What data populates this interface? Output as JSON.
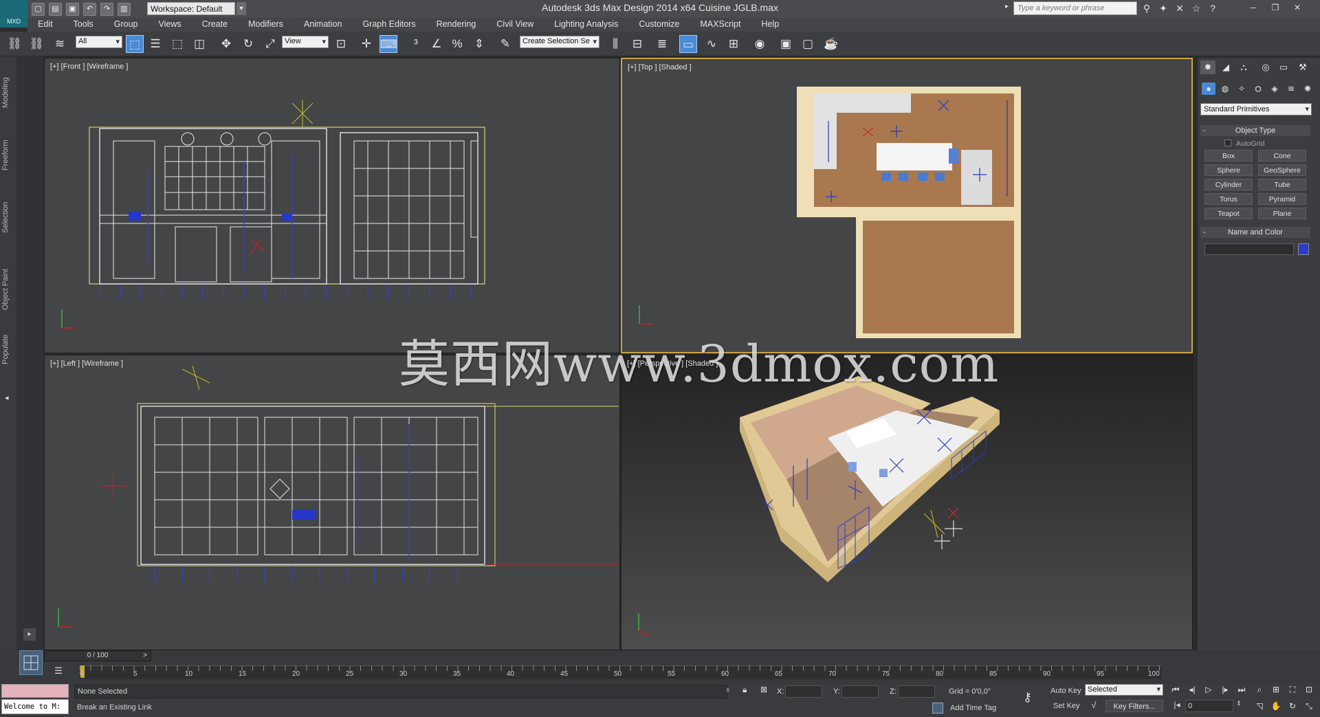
{
  "window": {
    "title": "Autodesk 3ds Max Design 2014 x64      Cuisine JGLB.max",
    "app_logo": "MXD",
    "workspace": "Workspace: Default",
    "search_placeholder": "Type a keyword or phrase"
  },
  "menu": [
    "Edit",
    "Tools",
    "Group",
    "Views",
    "Create",
    "Modifiers",
    "Animation",
    "Graph Editors",
    "Rendering",
    "Civil View",
    "Lighting Analysis",
    "Customize",
    "MAXScript",
    "Help"
  ],
  "toolbar": {
    "selection_filter": "All",
    "ref_coord": "View",
    "named_selection": "Create Selection Se"
  },
  "left_tabs": [
    "Modeling",
    "Freeform",
    "Selection",
    "Object Paint",
    "Populate"
  ],
  "viewports": {
    "front": "[+] [Front ] [Wireframe ]",
    "top": "[+] [Top ] [Shaded ]",
    "left": "[+] [Left ] [Wireframe ]",
    "perspective": "[+] [Perspective ] [Shaded ]"
  },
  "command_panel": {
    "category": "Standard Primitives",
    "object_type_title": "Object Type",
    "autogrid": "AutoGrid",
    "primitives": [
      "Box",
      "Cone",
      "Sphere",
      "GeoSphere",
      "Cylinder",
      "Tube",
      "Torus",
      "Pyramid",
      "Teapot",
      "Plane"
    ],
    "name_color_title": "Name and Color",
    "object_color": "#2c3bc9"
  },
  "timeline": {
    "slider": "0 / 100",
    "ticks": [
      "0",
      "5",
      "10",
      "15",
      "20",
      "25",
      "30",
      "35",
      "40",
      "45",
      "50",
      "55",
      "60",
      "65",
      "70",
      "75",
      "80",
      "85",
      "90",
      "95",
      "100"
    ]
  },
  "status": {
    "maxscript_output": "Welcome to M:",
    "selection": "None Selected",
    "prompt": "Break an Existing Link",
    "x_label": "X:",
    "y_label": "Y:",
    "z_label": "Z:",
    "grid": "Grid = 0'0,0\"",
    "add_time_tag": "Add Time Tag",
    "auto_key": "Auto Key",
    "set_key": "Set Key",
    "key_mode": "Selected",
    "key_filters": "Key Filters...",
    "current_frame": "0"
  },
  "watermark": "莫西网www.3dmox.com",
  "colors": {
    "accent": "#4a8ad6",
    "active_viewport": "#c8a645",
    "floor": "#a87a55",
    "wall": "#e8d6a6"
  }
}
